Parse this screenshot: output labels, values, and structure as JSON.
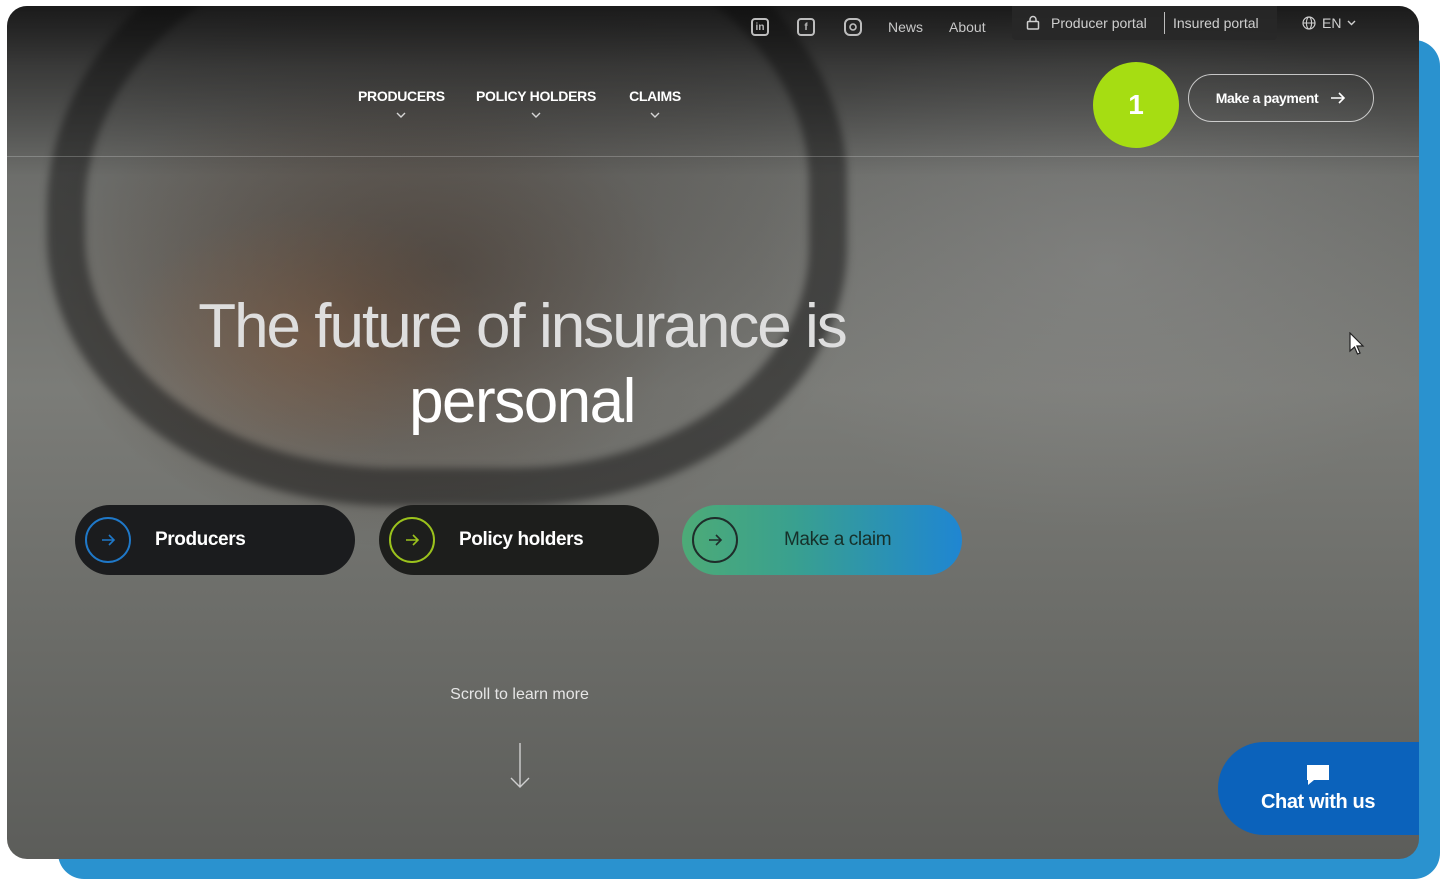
{
  "utility_bar": {
    "social": [
      "linkedin-icon",
      "facebook-icon",
      "instagram-icon"
    ],
    "news_label": "News",
    "about_label": "About",
    "producer_portal_label": "Producer portal",
    "insured_portal_label": "Insured portal",
    "language_label": "EN"
  },
  "nav": {
    "items": [
      {
        "label": "PRODUCERS"
      },
      {
        "label": "POLICY HOLDERS"
      },
      {
        "label": "CLAIMS"
      }
    ],
    "step_badge": "1",
    "payment_label": "Make a payment"
  },
  "hero": {
    "title_line1": "The future of insurance is",
    "title_line2": "personal",
    "ctas": [
      {
        "label": "Producers"
      },
      {
        "label": "Policy holders"
      },
      {
        "label": "Make a claim"
      }
    ],
    "scroll_label": "Scroll to learn more"
  },
  "chat": {
    "label": "Chat with us"
  },
  "colors": {
    "frame_accent": "#2a92cf",
    "badge_green": "#a6dd12",
    "chat_blue": "#0b62bb",
    "producers_ring": "#1f78c8",
    "policy_ring": "#9bc21c"
  }
}
